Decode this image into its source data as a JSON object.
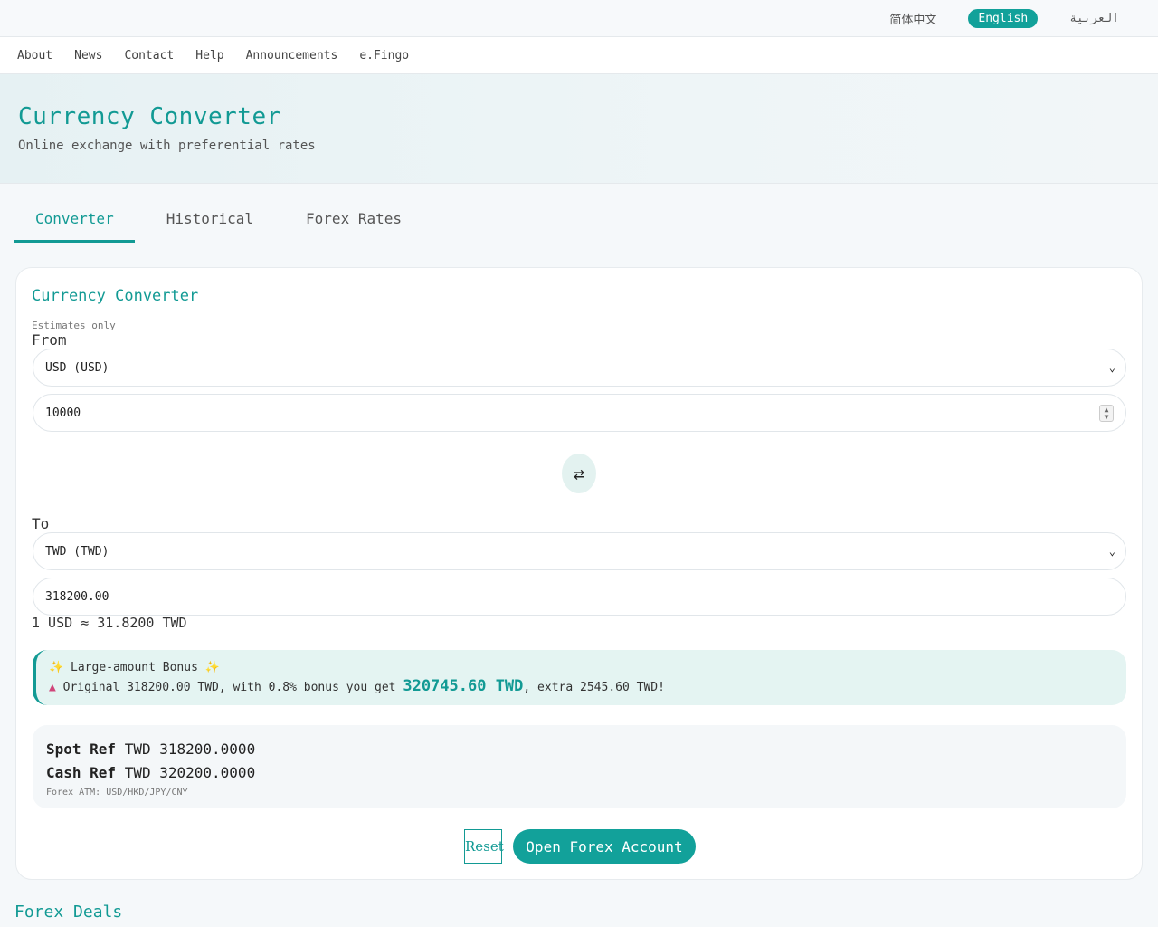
{
  "languages": [
    {
      "label": "简体中文",
      "active": false
    },
    {
      "label": "English",
      "active": true
    },
    {
      "label": "العربية",
      "active": false
    }
  ],
  "nav": [
    "About",
    "News",
    "Contact",
    "Help",
    "Announcements",
    "e.Fingo"
  ],
  "hero": {
    "title": "Currency Converter",
    "subtitle": "Online exchange with preferential rates"
  },
  "tabs": [
    {
      "label": "Converter",
      "active": true
    },
    {
      "label": "Historical",
      "active": false
    },
    {
      "label": "Forex Rates",
      "active": false
    }
  ],
  "converter": {
    "title": "Currency Converter",
    "note": "Estimates only",
    "from_label": "From",
    "from_currency": "USD (USD)",
    "from_amount": "10000",
    "swap_icon": "⇄",
    "to_label": "To",
    "to_currency": "TWD (TWD)",
    "to_amount": "318200.00",
    "rate_text": "1 USD ≈ 31.8200 TWD"
  },
  "bonus": {
    "title": "Large-amount Bonus",
    "text_before": "Original 318200.00 TWD, with 0.8% bonus you get",
    "highlight": "320745.60 TWD",
    "text_after": ", extra 2545.60 TWD!"
  },
  "refs": {
    "spot_label": "Spot Ref",
    "spot_value": "TWD 318200.0000",
    "cash_label": "Cash Ref",
    "cash_value": "TWD 320200.0000",
    "atm_note": "Forex ATM: USD/HKD/JPY/CNY"
  },
  "actions": {
    "reset": "Reset",
    "open": "Open Forex Account"
  },
  "footer_section": "Forex Deals",
  "colors": {
    "accent": "#12a19a",
    "bonus_bg": "#e4f4f2"
  }
}
